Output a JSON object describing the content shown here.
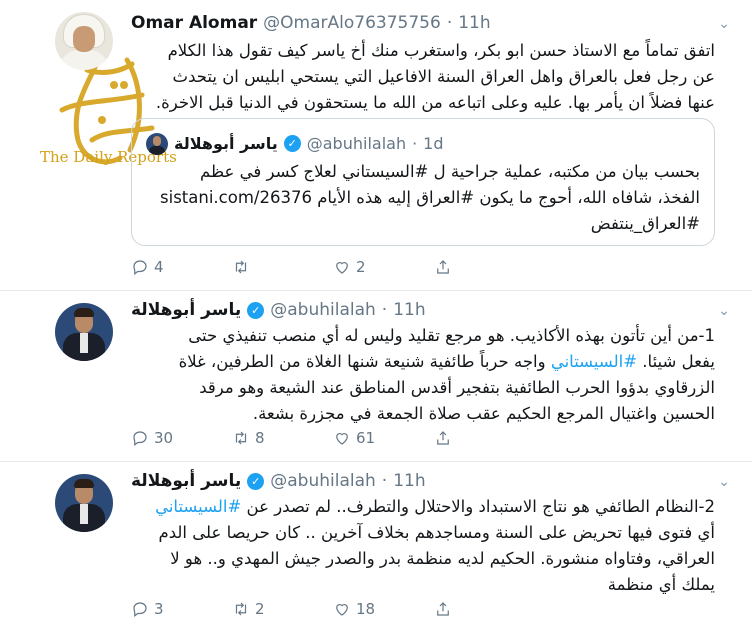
{
  "colors": {
    "link": "#1da1f2",
    "muted": "#657786",
    "text": "#14171a",
    "verified": "#1da1f2",
    "watermark": "#d4a017"
  },
  "tweets": [
    {
      "name": "Omar Alomar",
      "handle": "@OmarAlo76375756",
      "sep": "·",
      "time": "11h",
      "lines": [
        "اتفق تماماً مع الاستاذ حسن ابو بكر، واستغرب منك أخ ياسر كيف تقول هذا الكلام",
        "عن رجل فعل بالعراق واهل العراق السنة الافاعيل التي يستحي ابليس ان يتحدث",
        "عنها فضلاً ان يأمر بها. عليه وعلى اتباعه من الله ما يستحقون في الدنيا قبل الاخرة."
      ],
      "quote": {
        "name": "ياسر أبوهلالة",
        "handle": "@abuhilalah",
        "sep": "·",
        "time": "1d",
        "line1": "بحسب بيان من مكتبه، عملية جراحية ل #السيستاني لعلاج كسر في عظم",
        "line2": "الفخذ، شافاه الله، أحوج ما يكون #العراق إليه هذه الأيام",
        "line2_link": "sistani.com/26376",
        "line3": "#العراق_ينتفض"
      },
      "actions": {
        "replies": "4",
        "retweets": "",
        "likes": "2",
        "share": ""
      }
    },
    {
      "name": "ياسر أبوهلالة",
      "handle": "@abuhilalah",
      "sep": "·",
      "time": "11h",
      "line1": "1-من أين تأتون بهذه الأكاذيب. هو مرجع تقليد وليس له أي منصب تنفيذي حتى",
      "line2_pre": "يفعل شيئا. ",
      "line2_tag": "#السيستاني",
      "line2_post": " واجه حرباً طائفية شنيعة شنها الغلاة من الطرفين، غلاة",
      "line3": "الزرقاوي بدؤوا الحرب الطائفية بتفجير أقدس المناطق عند الشيعة وهو مرقد",
      "line4": "الحسين واغتيال المرجع الحكيم عقب صلاة الجمعة في مجزرة بشعة.",
      "actions": {
        "replies": "30",
        "retweets": "8",
        "likes": "61",
        "share": ""
      }
    },
    {
      "name": "ياسر أبوهلالة",
      "handle": "@abuhilalah",
      "sep": "·",
      "time": "11h",
      "line1_pre": "2-النظام الطائفي هو نتاج الاستبداد والاحتلال والتطرف.. لم تصدر عن ",
      "line1_tag": "#السيستاني",
      "line2": "أي فتوى فيها تحريض على السنة ومساجدهم بخلاف آخرين .. كان حريصا على الدم",
      "line3": "العراقي، وفتاواه منشورة. الحكيم لديه منظمة بدر والصدر جيش المهدي و.. هو لا",
      "line4": "يملك أي منظمة",
      "actions": {
        "replies": "3",
        "retweets": "2",
        "likes": "18",
        "share": ""
      }
    }
  ],
  "watermark": {
    "label": "The Daily Reports"
  }
}
